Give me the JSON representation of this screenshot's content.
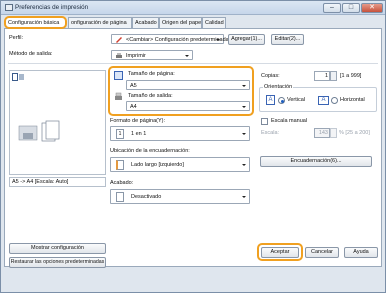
{
  "window": {
    "title": "Preferencias de impresión",
    "minimize": "–",
    "maximize": "□",
    "close": "✕"
  },
  "tabs": [
    {
      "label": "Configuración básica"
    },
    {
      "label": "onfiguración de página"
    },
    {
      "label": "Acabado"
    },
    {
      "label": "Origen del papel"
    },
    {
      "label": "Calidad"
    }
  ],
  "profile": {
    "label": "Perfil:",
    "value": "<Cambiar> Configuración predeterminada",
    "add_button": "Agregar(1)...",
    "edit_button": "Editar(2)..."
  },
  "output_method": {
    "label": "Método de salida:",
    "value": "Imprimir"
  },
  "page_size": {
    "label": "Tamaño de página:",
    "value": "A5"
  },
  "output_size": {
    "label": "Tamaño de salida:",
    "value": "A4"
  },
  "preview": {
    "caption": "A5 -> A4 [Escala: Auto]"
  },
  "copies": {
    "label": "Copias:",
    "value": "1",
    "range": "[1 a 999]"
  },
  "orientation": {
    "label": "Orientación",
    "vertical": "Vertical",
    "horizontal": "Horizontal"
  },
  "page_layout": {
    "label": "Formato de página(Y):",
    "value": "1 en 1",
    "icon_text": "1"
  },
  "manual_scale": {
    "label": "Escala manual",
    "scale_label": "Escala:",
    "value": "143",
    "range": "% [25 a 200]"
  },
  "binding": {
    "label": "Ubicación de la encuadernación:",
    "value": "Lado largo [izquierdo]",
    "button": "Encuadernación(6)..."
  },
  "finishing": {
    "label": "Acabado:",
    "value": "Desactivado"
  },
  "left_buttons": {
    "show_settings": "Mostrar configuración",
    "restore_defaults": "Restaurar las opciones predeterminadas"
  },
  "footer": {
    "ok": "Aceptar",
    "cancel": "Cancelar",
    "help": "Ayuda"
  }
}
